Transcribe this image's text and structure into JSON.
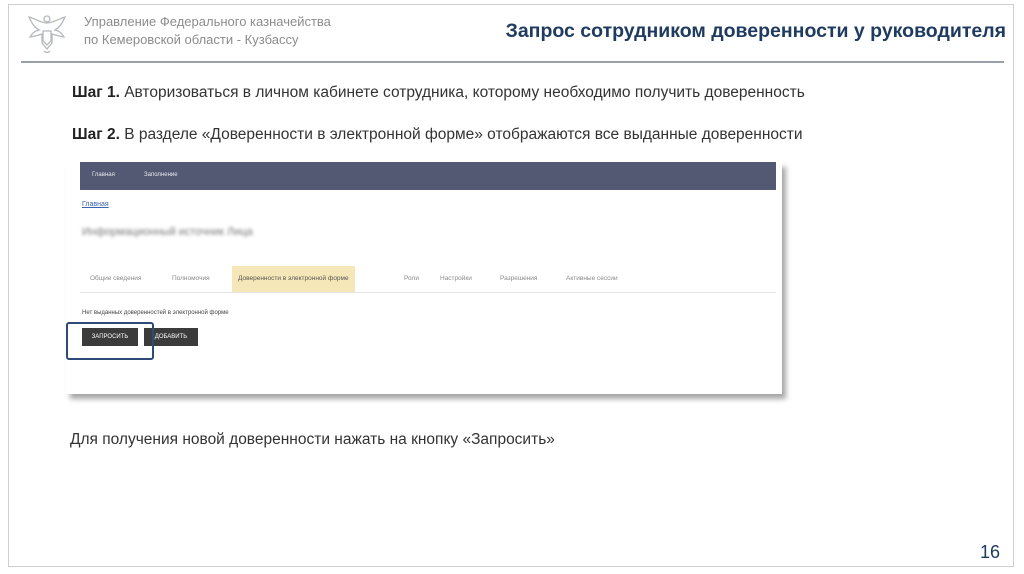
{
  "header": {
    "org_line1": "Управление Федерального казначейства",
    "org_line2": "по Кемеровской области - Кузбассу",
    "title": "Запрос сотрудником доверенности у руководителя"
  },
  "steps": [
    {
      "label": "Шаг 1.",
      "text": "Авторизоваться в личном кабинете сотрудника, которому необходимо получить доверенность"
    },
    {
      "label": "Шаг 2.",
      "text": "В разделе «Доверенности в электронной форме» отображаются все выданные доверенности"
    }
  ],
  "screenshot": {
    "nav": [
      "Главная",
      "Заполнение"
    ],
    "breadcrumb": "Главная",
    "name": "Информационный источник Лица",
    "tabs": [
      "Общие сведения",
      "Полномочия",
      "Доверенности в электронной форме",
      "Роли",
      "Настройки",
      "Разрешения",
      "Активные сессии"
    ],
    "active_tab": "Доверенности в электронной форме",
    "notice": "Нет выданных доверенностей в электронной форме",
    "request_button": "ЗАПРОСИТЬ",
    "add_button": "ДОБАВИТЬ"
  },
  "note": "Для получения новой доверенности нажать на кнопку «Запросить»",
  "page_number": "16",
  "colors": {
    "title": "#1f3b60",
    "nav": "#535972",
    "active_tab": "#f6e7b8",
    "highlight": "#2e4a78"
  }
}
